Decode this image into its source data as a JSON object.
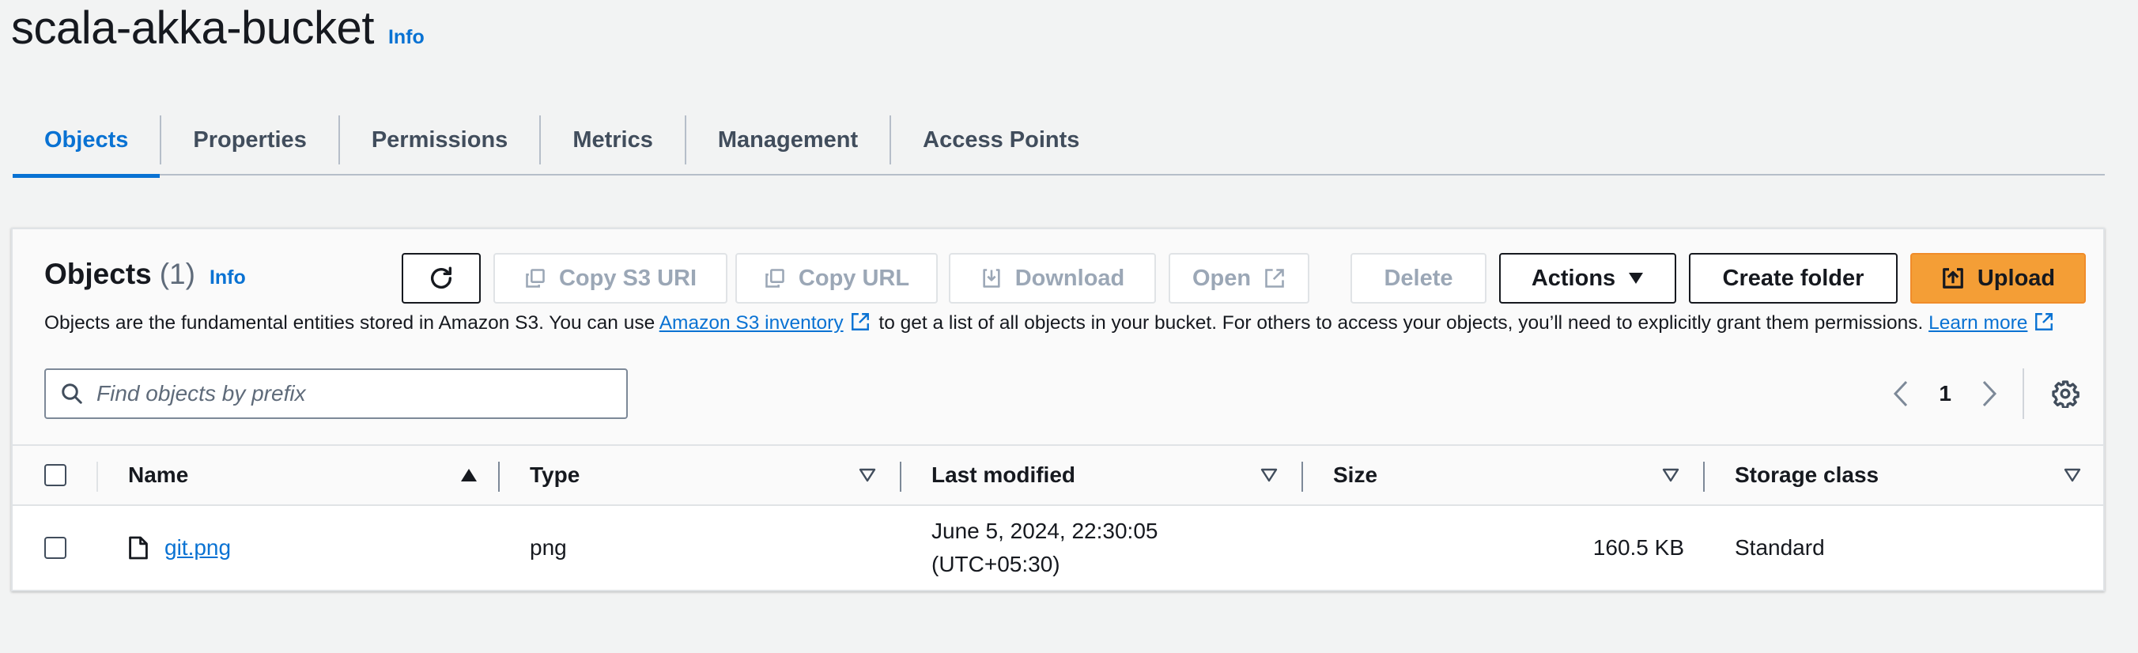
{
  "header": {
    "title": "scala-akka-bucket",
    "info_label": "Info"
  },
  "tabs": [
    {
      "label": "Objects",
      "active": true
    },
    {
      "label": "Properties"
    },
    {
      "label": "Permissions"
    },
    {
      "label": "Metrics"
    },
    {
      "label": "Management"
    },
    {
      "label": "Access Points"
    }
  ],
  "objects_panel": {
    "title": "Objects",
    "count": "(1)",
    "info_label": "Info",
    "buttons": {
      "refresh_icon": "refresh-icon",
      "copy_s3_uri": "Copy S3 URI",
      "copy_url": "Copy URL",
      "download": "Download",
      "open": "Open",
      "delete": "Delete",
      "actions": "Actions",
      "create_folder": "Create folder",
      "upload": "Upload"
    },
    "description": {
      "part1": "Objects are the fundamental entities stored in Amazon S3. You can use ",
      "inventory_link": "Amazon S3 inventory",
      "part2": " to get a list of all objects in your bucket. For others to access your objects, you’ll need to explicitly grant them permissions. ",
      "learn_more_link": "Learn more"
    },
    "search": {
      "placeholder": "Find objects by prefix",
      "value": ""
    },
    "pagination": {
      "current_page": "1"
    }
  },
  "table": {
    "columns": [
      "Name",
      "Type",
      "Last modified",
      "Size",
      "Storage class"
    ],
    "rows": [
      {
        "name": "git.png",
        "type": "png",
        "last_modified_line1": "June 5, 2024, 22:30:05",
        "last_modified_line2": "(UTC+05:30)",
        "size": "160.5 KB",
        "storage_class": "Standard"
      }
    ]
  },
  "colors": {
    "accent": "#0972d3",
    "primary_button": "#f49e36",
    "text": "#16191f",
    "disabled": "#9ba7b6",
    "background": "#f2f3f3"
  }
}
